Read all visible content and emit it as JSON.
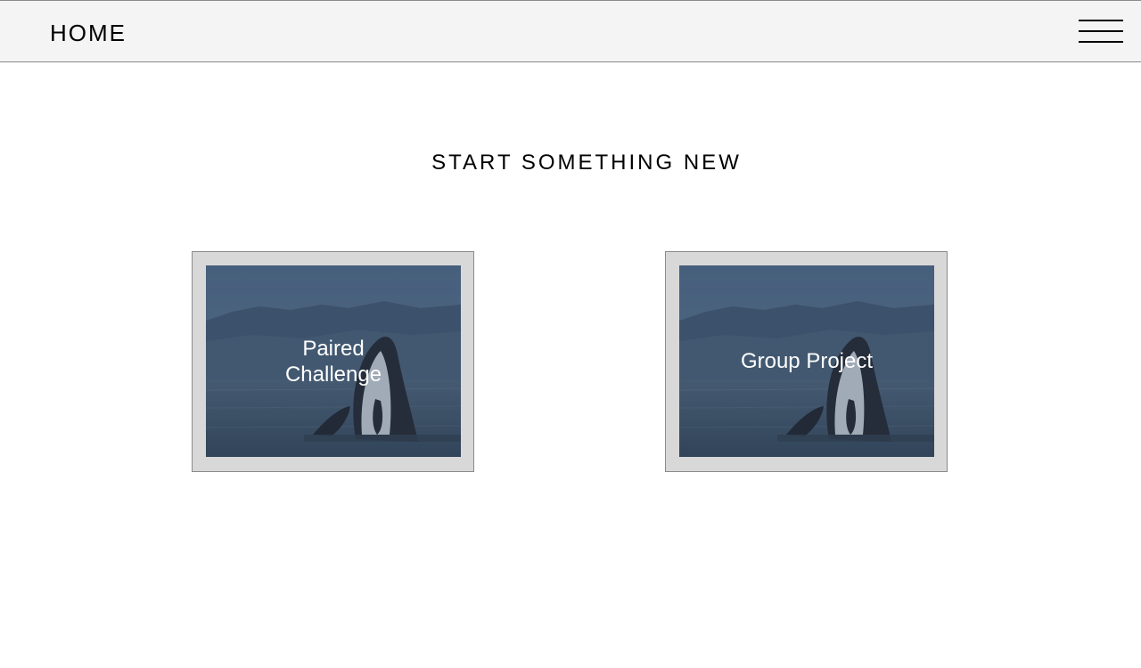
{
  "header": {
    "title": "HOME",
    "menu_icon": "hamburger-menu-icon"
  },
  "main": {
    "heading": "START SOMETHING NEW",
    "cards": [
      {
        "label": "Paired Challenge",
        "image": "orca-breaching-image"
      },
      {
        "label": "Group Project",
        "image": "orca-breaching-image"
      }
    ]
  },
  "colors": {
    "header_bg": "#f4f4f4",
    "card_frame": "#d9d8d8",
    "card_border": "#8a8a8a",
    "overlay_blue": "#4a6078",
    "label_text": "#ffffff"
  }
}
